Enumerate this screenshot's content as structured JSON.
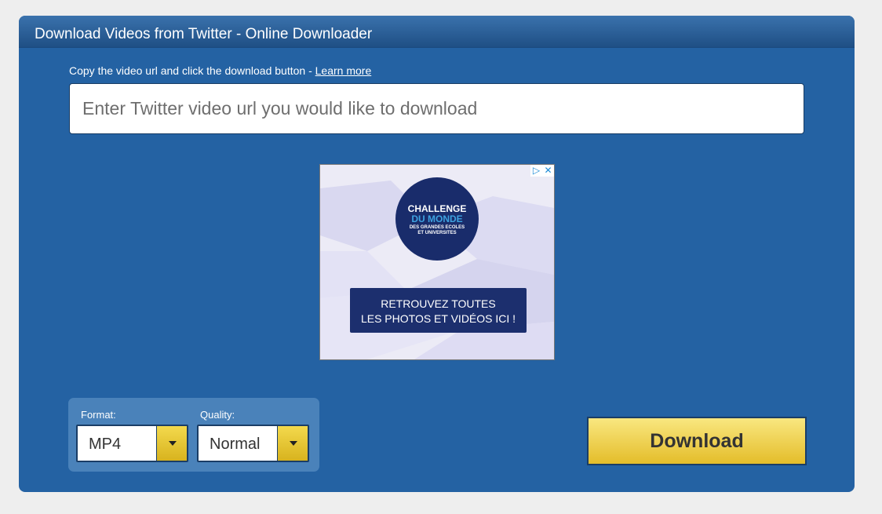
{
  "header": {
    "title": "Download Videos from Twitter - Online Downloader"
  },
  "instructions": {
    "text": "Copy the video url and click the download button - ",
    "link": "Learn more"
  },
  "url_input": {
    "value": "",
    "placeholder": "Enter Twitter video url you would like to download"
  },
  "ad": {
    "choices_icon": "adchoices-icon",
    "close_icon": "close-icon",
    "logo_line1": "CHALLENGE",
    "logo_line2": "DU MONDE",
    "logo_line3": "DES GRANDES ECOLES",
    "logo_line4": "ET UNIVERSITES",
    "cta_line1": "RETROUVEZ TOUTES",
    "cta_line2": "LES PHOTOS ET VIDÉOS ICI !"
  },
  "options": {
    "format_label": "Format:",
    "format_value": "MP4",
    "quality_label": "Quality:",
    "quality_value": "Normal"
  },
  "download_button": {
    "label": "Download"
  },
  "colors": {
    "panel": "#2462a3",
    "button": "#f2d246",
    "ad_navy": "#192c6b"
  }
}
